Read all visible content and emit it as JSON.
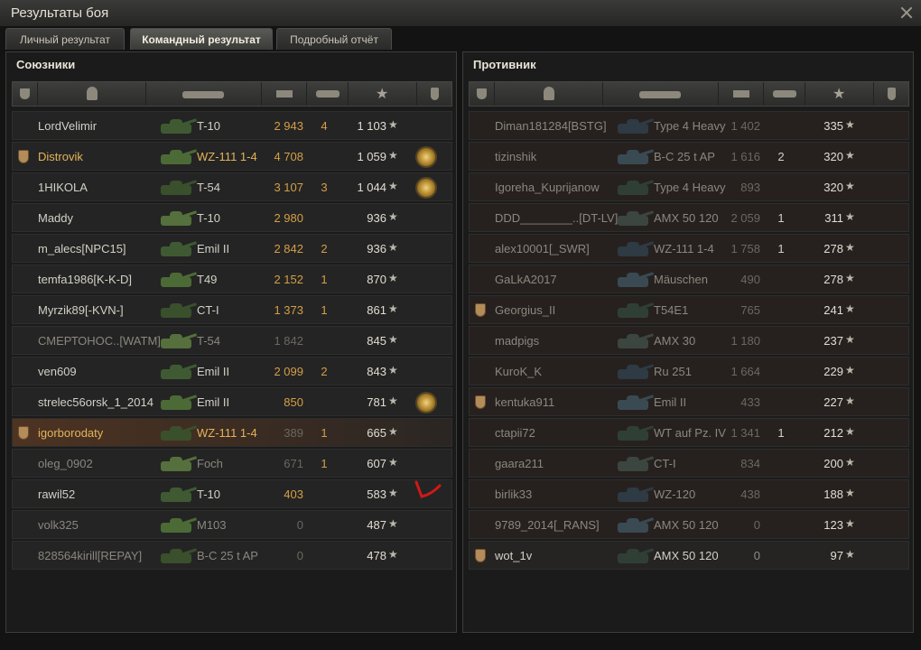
{
  "window": {
    "title": "Результаты боя"
  },
  "tabs": [
    "Личный результат",
    "Командный результат",
    "Подробный отчёт"
  ],
  "active_tab": 1,
  "allies": {
    "title": "Союзники",
    "rows": [
      {
        "name": "LordVelimir",
        "tank": "T-10",
        "damage": "2 943",
        "frags": "4",
        "xp": "1 103",
        "clan_icon": false,
        "medal": false,
        "dead": false,
        "highlight": false,
        "gold": false
      },
      {
        "name": "Distrovik",
        "tank": "WZ-111 1-4",
        "damage": "4 708",
        "frags": "",
        "xp": "1 059",
        "clan_icon": true,
        "medal": true,
        "dead": false,
        "highlight": false,
        "gold": true
      },
      {
        "name": "1HIKOLA",
        "tank": "T-54",
        "damage": "3 107",
        "frags": "3",
        "xp": "1 044",
        "clan_icon": false,
        "medal": true,
        "dead": false,
        "highlight": false,
        "gold": false
      },
      {
        "name": "Maddy",
        "tank": "T-10",
        "damage": "2 980",
        "frags": "",
        "xp": "936",
        "clan_icon": false,
        "medal": false,
        "dead": false,
        "highlight": false,
        "gold": false
      },
      {
        "name": "m_alecs[NPC15]",
        "tank": "Emil II",
        "damage": "2 842",
        "frags": "2",
        "xp": "936",
        "clan_icon": false,
        "medal": false,
        "dead": false,
        "highlight": false,
        "gold": false
      },
      {
        "name": "temfa1986[K-K-D]",
        "tank": "T49",
        "damage": "2 152",
        "frags": "1",
        "xp": "870",
        "clan_icon": false,
        "medal": false,
        "dead": false,
        "highlight": false,
        "gold": false
      },
      {
        "name": "Myrzik89[-KVN-]",
        "tank": "CT-I",
        "damage": "1 373",
        "frags": "1",
        "xp": "861",
        "clan_icon": false,
        "medal": false,
        "dead": false,
        "highlight": false,
        "gold": false
      },
      {
        "name": "СМЕРТОНОС..[WATM]",
        "tank": "T-54",
        "damage": "1 842",
        "frags": "",
        "xp": "845",
        "clan_icon": false,
        "medal": false,
        "dead": true,
        "highlight": false,
        "gold": false
      },
      {
        "name": "ven609",
        "tank": "Emil II",
        "damage": "2 099",
        "frags": "2",
        "xp": "843",
        "clan_icon": false,
        "medal": false,
        "dead": false,
        "highlight": false,
        "gold": false
      },
      {
        "name": "strelec56orsk_1_2014",
        "tank": "Emil II",
        "damage": "850",
        "frags": "",
        "xp": "781",
        "clan_icon": false,
        "medal": true,
        "dead": false,
        "highlight": false,
        "gold": false
      },
      {
        "name": "igorborodaty",
        "tank": "WZ-111 1-4",
        "damage": "389",
        "frags": "1",
        "xp": "665",
        "clan_icon": true,
        "medal": false,
        "dead": true,
        "highlight": true,
        "gold": true
      },
      {
        "name": "oleg_0902",
        "tank": "Foch",
        "damage": "671",
        "frags": "1",
        "xp": "607",
        "clan_icon": false,
        "medal": false,
        "dead": true,
        "highlight": false,
        "gold": false
      },
      {
        "name": "rawil52",
        "tank": "T-10",
        "damage": "403",
        "frags": "",
        "xp": "583",
        "clan_icon": false,
        "medal": false,
        "dead": false,
        "highlight": false,
        "gold": false
      },
      {
        "name": "volk325",
        "tank": "M103",
        "damage": "0",
        "frags": "",
        "xp": "487",
        "clan_icon": false,
        "medal": false,
        "dead": true,
        "highlight": false,
        "gold": false
      },
      {
        "name": "828564kirill[REPAY]",
        "tank": "B-C 25 t AP",
        "damage": "0",
        "frags": "",
        "xp": "478",
        "clan_icon": false,
        "medal": false,
        "dead": true,
        "highlight": false,
        "gold": false
      }
    ]
  },
  "enemies": {
    "title": "Противник",
    "rows": [
      {
        "name": "Diman181284[BSTG]",
        "tank": "Type 4 Heavy",
        "damage": "1 402",
        "frags": "",
        "xp": "335",
        "clan_icon": false,
        "dead": true
      },
      {
        "name": "tizinshik",
        "tank": "B-C 25 t AP",
        "damage": "1 616",
        "frags": "2",
        "xp": "320",
        "clan_icon": false,
        "dead": true
      },
      {
        "name": "Igoreha_Kuprijanow",
        "tank": "Type 4 Heavy",
        "damage": "893",
        "frags": "",
        "xp": "320",
        "clan_icon": false,
        "dead": true
      },
      {
        "name": "DDD________..[DT-LV]",
        "tank": "AMX 50 120",
        "damage": "2 059",
        "frags": "1",
        "xp": "311",
        "clan_icon": false,
        "dead": true
      },
      {
        "name": "alex10001[_SWR]",
        "tank": "WZ-111 1-4",
        "damage": "1 758",
        "frags": "1",
        "xp": "278",
        "clan_icon": false,
        "dead": true
      },
      {
        "name": "GaLkA2017",
        "tank": "Mäuschen",
        "damage": "490",
        "frags": "",
        "xp": "278",
        "clan_icon": false,
        "dead": true
      },
      {
        "name": "Georgius_II",
        "tank": "T54E1",
        "damage": "765",
        "frags": "",
        "xp": "241",
        "clan_icon": true,
        "dead": true
      },
      {
        "name": "madpigs",
        "tank": "AMX 30",
        "damage": "1 180",
        "frags": "",
        "xp": "237",
        "clan_icon": false,
        "dead": true
      },
      {
        "name": "KuroK_K",
        "tank": "Ru 251",
        "damage": "1 664",
        "frags": "",
        "xp": "229",
        "clan_icon": false,
        "dead": true
      },
      {
        "name": "kentuka911",
        "tank": "Emil II",
        "damage": "433",
        "frags": "",
        "xp": "227",
        "clan_icon": true,
        "dead": true
      },
      {
        "name": "ctapii72",
        "tank": "WT auf Pz. IV",
        "damage": "1 341",
        "frags": "1",
        "xp": "212",
        "clan_icon": false,
        "dead": true
      },
      {
        "name": "gaara211",
        "tank": "CT-I",
        "damage": "834",
        "frags": "",
        "xp": "200",
        "clan_icon": false,
        "dead": true
      },
      {
        "name": "birlik33",
        "tank": "WZ-120",
        "damage": "438",
        "frags": "",
        "xp": "188",
        "clan_icon": false,
        "dead": true
      },
      {
        "name": "9789_2014[_RANS]",
        "tank": "AMX 50 120",
        "damage": "0",
        "frags": "",
        "xp": "123",
        "clan_icon": false,
        "dead": true
      },
      {
        "name": "wot_1v",
        "tank": "AMX 50 120",
        "damage": "0",
        "frags": "",
        "xp": "97",
        "clan_icon": true,
        "dead": false
      }
    ]
  },
  "columns": [
    "clan-icon",
    "player-icon",
    "tank-icon",
    "damage-icon",
    "frags-icon",
    "xp-star-icon",
    "medal-icon"
  ]
}
